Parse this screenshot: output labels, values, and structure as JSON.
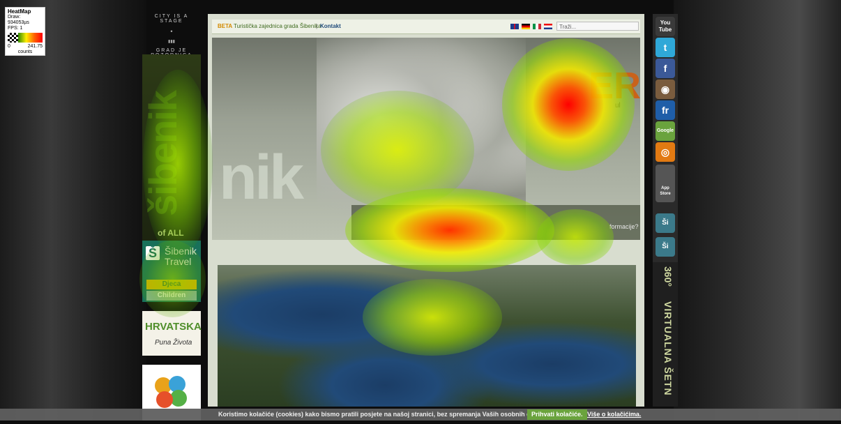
{
  "legend": {
    "title": "HeatMap",
    "draw": "Draw: 934053µs",
    "fps": "FPS: 1",
    "min": "0",
    "max": "241.75",
    "unit": "counts"
  },
  "left_column": {
    "tagline_top": "CITY IS A STAGE",
    "tagline_bottom": "GRAD JE POZORNICA",
    "logo_word": "šibenik",
    "logo_suffix": "of ALL",
    "travel_name": "Šibenik Travel",
    "travel_sub1": "Djeca",
    "travel_sub2": "Children",
    "hrvatska_brand": "HRVATSKA",
    "hrvatska_motto": "Puna Života"
  },
  "header": {
    "beta": "BETA",
    "org": "Turistička zajednica grada Šibenika",
    "separator": "|",
    "contact": "Kontakt",
    "search_placeholder": "Traži..."
  },
  "banner": {
    "logo": "nik",
    "headline_fragment": "ER",
    "side_fragment": "ul",
    "info_text": "formacije?"
  },
  "social": {
    "youtube": "You Tube",
    "twitter": "t",
    "facebook": "f",
    "instagram": "◉",
    "flickr": "fr",
    "google": "Google",
    "other": "◎",
    "appstore": "App Store",
    "si1": "Ši",
    "si2": "Ši"
  },
  "virtual_walk": {
    "degrees": "360°",
    "text": "VIRTUALNA ŠETN"
  },
  "cookie_bar": {
    "message": "Koristimo kolačiće (cookies) kako bismo pratili posjete na našoj stranici, bez spremanja Vaših osobnih detalja.",
    "accept": "Prihvati kolačiće.",
    "more": "Više o kolačićima."
  },
  "colors": {
    "heat_low": "#a8e000",
    "heat_mid": "#f0f000",
    "heat_high": "#ff2000",
    "accent_green": "#6aa33d"
  }
}
